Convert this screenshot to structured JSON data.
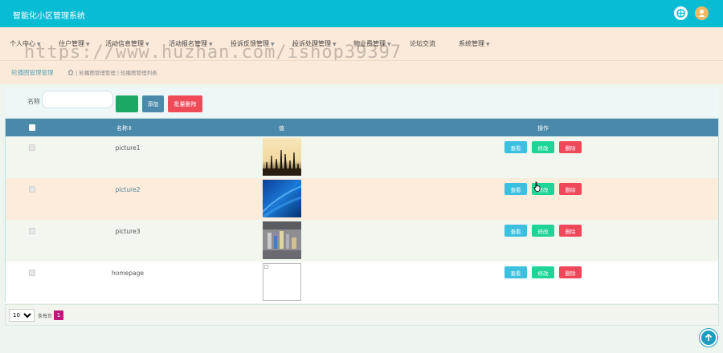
{
  "app": {
    "title": "智能化小区管理系统"
  },
  "nav": {
    "items": [
      {
        "label": "个人中心"
      },
      {
        "label": "住户管理"
      },
      {
        "label": "活动信息管理"
      },
      {
        "label": "活动报名管理"
      },
      {
        "label": "投诉反馈管理"
      },
      {
        "label": "投诉处理管理"
      },
      {
        "label": "物业费管理"
      },
      {
        "label": "论坛交流"
      },
      {
        "label": "系统管理"
      }
    ],
    "watermark": "https://www.huzhan.com/ishop39397"
  },
  "breadcrumb": {
    "title": "轮播图管理管理",
    "path": "| 轮播图管理管理 | 轮播图管理列表"
  },
  "search": {
    "label": "名称",
    "placeholder": "",
    "search_button": "",
    "add_button": "添加",
    "batch_delete_button": "批量删除"
  },
  "table": {
    "columns": {
      "name": "名称",
      "value": "值",
      "actions": "操作"
    },
    "sort_icon": "sort-icon",
    "rows": [
      {
        "name": "picture1",
        "image": "picture1-image"
      },
      {
        "name": "picture2",
        "image": "picture2-image"
      },
      {
        "name": "picture3",
        "image": "picture3-image"
      },
      {
        "name": "homepage",
        "image": "broken-image-icon"
      }
    ],
    "actions": {
      "view": "查看",
      "edit": "修改",
      "delete": "删除"
    }
  },
  "pagination": {
    "page_size": "10",
    "page_size_label": "条每页",
    "current_page": "1"
  },
  "colors": {
    "topbar": "#08bcd4",
    "nav_bg": "#fbe9d9",
    "table_header": "#4a89aa",
    "view": "#3cc0e0",
    "edit": "#1fd497",
    "delete": "#f0485a",
    "page_active": "#c0157a"
  }
}
